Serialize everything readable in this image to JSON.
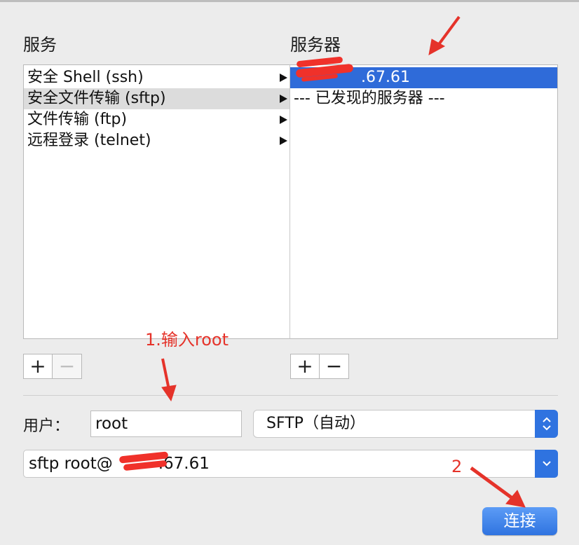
{
  "services_header": "服务",
  "servers_header": "服务器",
  "services": [
    {
      "label": "安全 Shell (ssh)"
    },
    {
      "label": "安全文件传输 (sftp)"
    },
    {
      "label": "文件传输 (ftp)"
    },
    {
      "label": "远程登录 (telnet)"
    }
  ],
  "servers": [
    {
      "label": ".67.61"
    },
    {
      "label": "--- 已发现的服务器 ---"
    }
  ],
  "controls": {
    "add_symbol": "+",
    "remove_symbol": "−"
  },
  "user": {
    "label": "用户：",
    "value": "root"
  },
  "protocol": {
    "selected": "SFTP（自动）"
  },
  "command": {
    "prefix": "sftp root@",
    "suffix": ".67.61"
  },
  "connect_label": "连接",
  "annotations": {
    "step1": "1.输入root",
    "step2": "2",
    "color": "#e5332a"
  },
  "colors": {
    "accent": "#2f73e0",
    "selection": "#2f6bd9"
  }
}
